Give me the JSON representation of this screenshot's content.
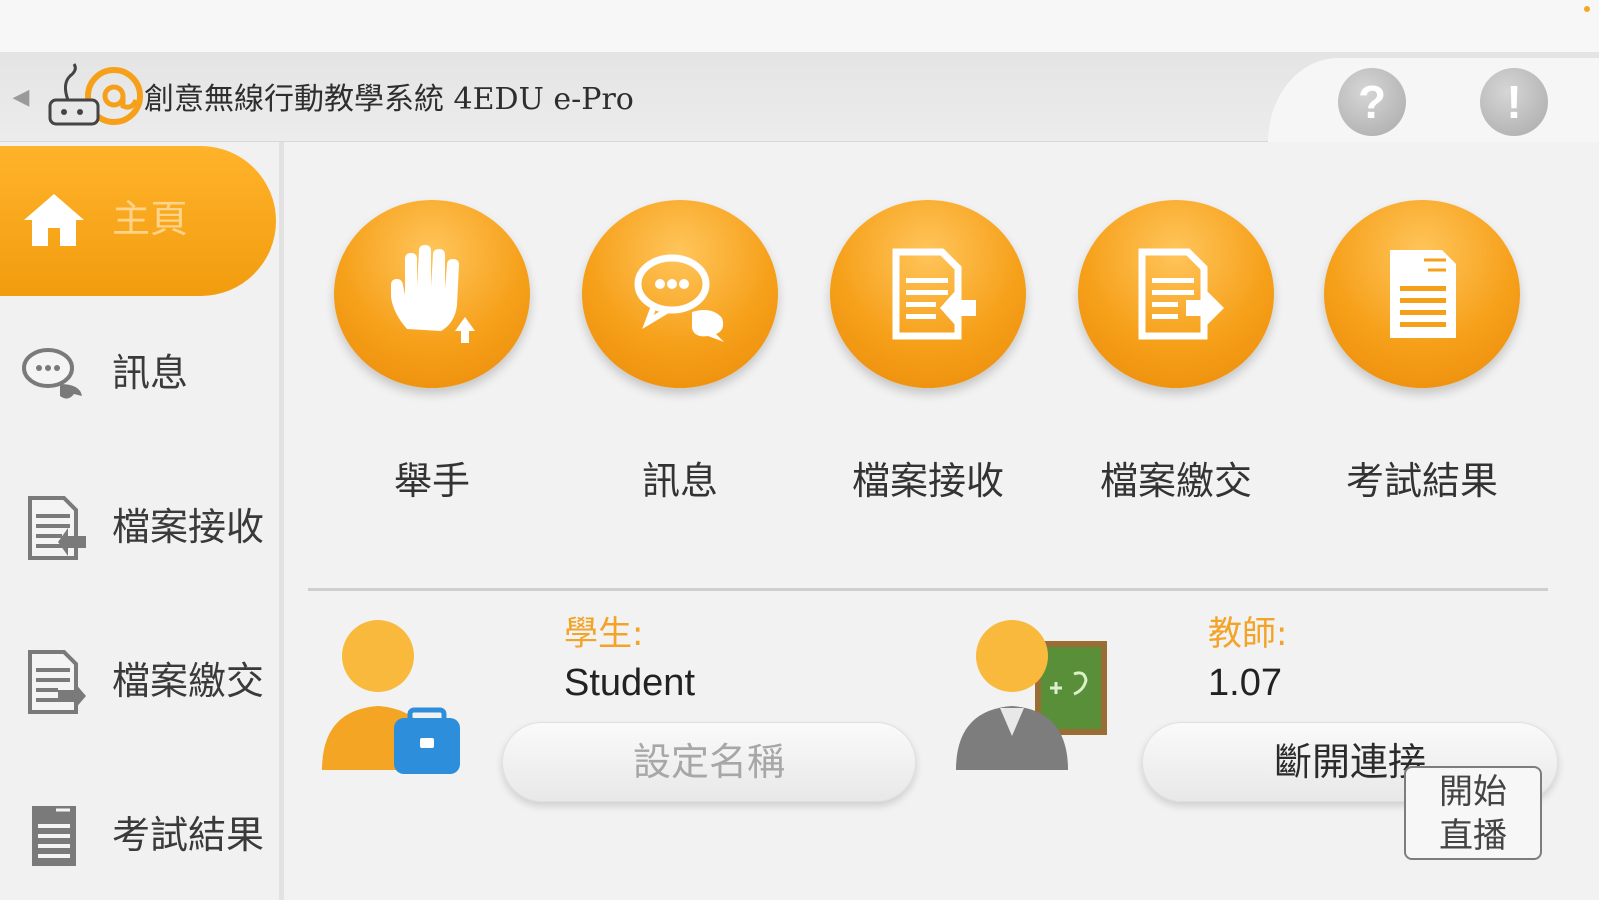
{
  "header": {
    "title": "創意無線行動教學系統 4EDU e-Pro",
    "back_icon": "chevron-left-icon",
    "help_icon": "question-icon",
    "alert_icon": "exclamation-icon",
    "help_glyph": "?",
    "alert_glyph": "!",
    "back_glyph": "◀"
  },
  "sidebar": {
    "items": [
      {
        "label": "主頁",
        "icon": "home-icon",
        "active": true
      },
      {
        "label": "訊息",
        "icon": "chat-bubbles-icon",
        "active": false
      },
      {
        "label": "檔案接收",
        "icon": "file-receive-icon",
        "active": false
      },
      {
        "label": "檔案繳交",
        "icon": "file-submit-icon",
        "active": false
      },
      {
        "label": "考試結果",
        "icon": "exam-result-icon",
        "active": false
      }
    ]
  },
  "functions": [
    {
      "label": "舉手",
      "icon": "raise-hand-icon"
    },
    {
      "label": "訊息",
      "icon": "chat-bubbles-icon"
    },
    {
      "label": "檔案接收",
      "icon": "file-receive-icon"
    },
    {
      "label": "檔案繳交",
      "icon": "file-submit-icon"
    },
    {
      "label": "考試結果",
      "icon": "exam-result-icon"
    }
  ],
  "student": {
    "caption": "學生:",
    "name": "Student",
    "set_name_button": "設定名稱"
  },
  "teacher": {
    "caption": "教師:",
    "value": "1.07",
    "disconnect_button": "斷開連接"
  },
  "live": {
    "line1": "開始",
    "line2": "直播"
  },
  "colors": {
    "accent": "#f6a01a",
    "caption": "#f3a428"
  }
}
